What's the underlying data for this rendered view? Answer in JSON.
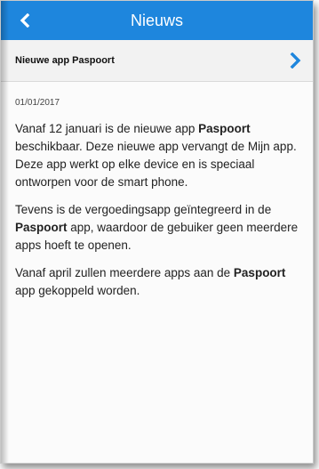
{
  "header": {
    "title": "Nieuws",
    "back_icon": "chevron-left-icon",
    "bar_color": "#1e86dd"
  },
  "subheader": {
    "label": "Nieuwe app Paspoort",
    "chevron_icon": "chevron-right-icon",
    "chevron_color": "#1e86dd"
  },
  "article": {
    "date": "01/01/2017",
    "p1_a": "Vanaf 12 januari is de nieuwe app ",
    "p1_bold": "Paspoort",
    "p1_b": " beschikbaar. Deze nieuwe app vervangt de Mijn app. Deze app werkt op elke device en is speciaal ontworpen voor de smart phone.",
    "p2_a": "Tevens is de vergoedingsapp geïntegreerd in de ",
    "p2_bold": "Paspoort",
    "p2_b": " app, waardoor de gebuiker geen meerdere apps hoeft te openen.",
    "p3_a": "Vanaf april zullen meerdere apps aan de ",
    "p3_bold": "Paspoort",
    "p3_b": " app gekoppeld worden."
  }
}
